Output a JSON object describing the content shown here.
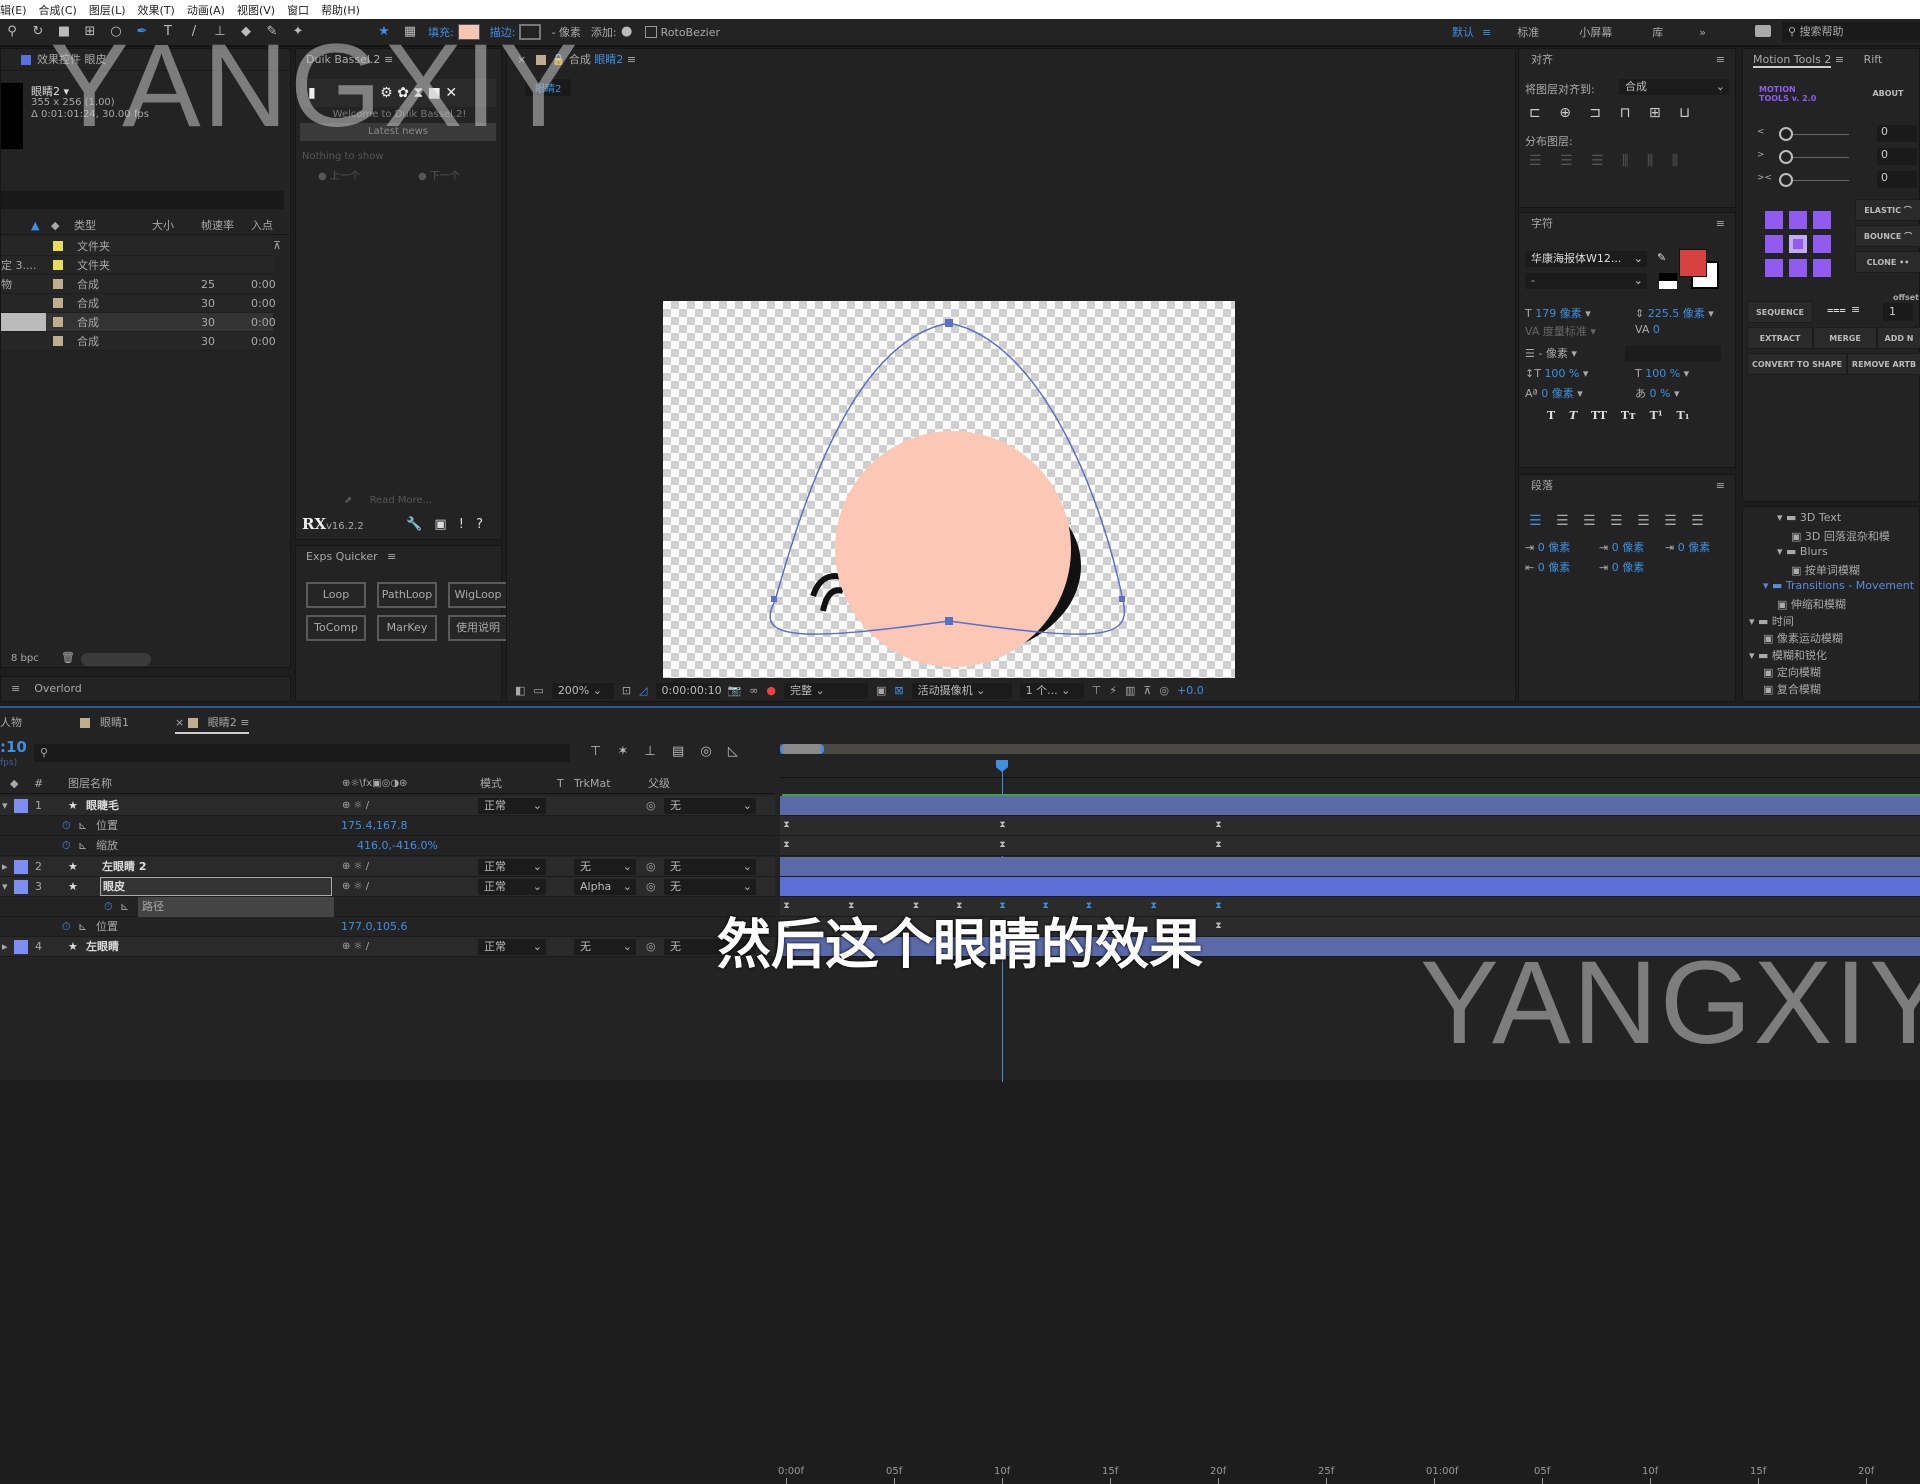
{
  "menu": [
    "辑(E)",
    "合成(C)",
    "图层(L)",
    "效果(T)",
    "动画(A)",
    "视图(V)",
    "窗口",
    "帮助(H)"
  ],
  "toolbar": {
    "fill_label": "填充:",
    "stroke_label": "描边:",
    "stroke_px": "- 像素",
    "add_label": "添加:",
    "rotobezier": "RotoBezier",
    "fill_color": "#f6c4b4",
    "workspaces": [
      "默认",
      "标准",
      "小屏幕",
      "库"
    ],
    "search_placeholder": "搜索帮助"
  },
  "project": {
    "tab": "效果控件 眼皮",
    "comp_name": "眼睛2 ▾",
    "comp_size": "355 x 256 (1.00)",
    "comp_duration": "Δ 0:01:01:24, 30.00 fps",
    "columns": [
      "类型",
      "大小",
      "帧速率",
      "入点"
    ],
    "items": [
      {
        "name": "",
        "type": "文件夹",
        "fps": "",
        "in": "",
        "color": "#e8de56"
      },
      {
        "name": "定 3....",
        "type": "文件夹",
        "fps": "",
        "in": "",
        "color": "#e8de56"
      },
      {
        "name": "物",
        "type": "合成",
        "fps": "25",
        "in": "0:00",
        "color": "#bfae8e"
      },
      {
        "name": "",
        "type": "合成",
        "fps": "30",
        "in": "0:00",
        "color": "#bfae8e"
      },
      {
        "name": "",
        "type": "合成",
        "fps": "30",
        "in": "0:00",
        "color": "#bfae8e"
      },
      {
        "name": "",
        "type": "合成",
        "fps": "30",
        "in": "0:00",
        "color": "#bfae8e"
      }
    ],
    "bpc": "8 bpc",
    "bottom_tab": "Overlord"
  },
  "duik": {
    "tab": "Duik Bassel.2",
    "welcome": "Welcome to Duik Bassel.2!",
    "latest_news": "Latest news",
    "nothing": "Nothing to show",
    "prev": "上一个",
    "next": "下一个",
    "read_more": "Read More...",
    "version": "v16.2.2",
    "logo": "RX"
  },
  "exps": {
    "tab": "Exps Quicker",
    "buttons": [
      "Loop",
      "PathLoop",
      "WigLoop",
      "ToComp",
      "MarKey",
      "使用说明"
    ]
  },
  "viewer": {
    "tab_comp": "合成",
    "tab_name": "眼睛2",
    "crumb": "眼睛2",
    "zoom": "200%",
    "timecode": "0:00:00:10",
    "quality": "完整",
    "camera": "活动摄像机",
    "views": "1 个...",
    "exposure": "+0.0"
  },
  "align": {
    "title": "对齐",
    "align_to_label": "将图层对齐到:",
    "align_to": "合成",
    "distribute_label": "分布图层:"
  },
  "character": {
    "title": "字符",
    "font": "华康海报体W12...",
    "style": "-",
    "fill_color": "#d94040",
    "size": "179 像素",
    "leading": "225.5 像素",
    "kerning": "度量标准",
    "tracking": "0",
    "stroke_width": "- 像素",
    "vscale": "100 %",
    "hscale": "100 %",
    "baseline": "0 像素",
    "tsume": "0 %"
  },
  "paragraph": {
    "title": "段落",
    "indents": [
      "0 像素",
      "0 像素",
      "0 像素",
      "0 像素",
      "0 像素"
    ]
  },
  "motion_tools": {
    "tab": "Motion Tools 2",
    "tab2": "Rift",
    "logo": "MOTION TOOLS v. 2.0",
    "about": "ABOUT",
    "sliders": [
      {
        "label": "<",
        "value": "0"
      },
      {
        "label": ">",
        "value": "0"
      },
      {
        "label": "><",
        "value": "0"
      }
    ],
    "elastic": "ELASTIC",
    "bounce": "BOUNCE",
    "clone": "CLONE",
    "offset_label": "offset",
    "sequence": "SEQUENCE",
    "offset": "1",
    "extract": "EXTRACT",
    "merge": "MERGE",
    "add": "ADD N",
    "convert": "CONVERT TO SHAPE",
    "remove": "REMOVE ARTB",
    "accent": "#8f5bf0"
  },
  "effects_tree": [
    {
      "label": "3D Text",
      "level": 2,
      "folder": true
    },
    {
      "label": "3D 回落混杂和模",
      "level": 3,
      "folder": false
    },
    {
      "label": "Blurs",
      "level": 2,
      "folder": true
    },
    {
      "label": "按单词模糊",
      "level": 3,
      "folder": false
    },
    {
      "label": "Transitions - Movement",
      "level": 1,
      "folder": true
    },
    {
      "label": "伸缩和模糊",
      "level": 2,
      "folder": false
    },
    {
      "label": "时间",
      "level": 0,
      "folder": true
    },
    {
      "label": "像素运动模糊",
      "level": 1,
      "folder": false
    },
    {
      "label": "模糊和锐化",
      "level": 0,
      "folder": true
    },
    {
      "label": "定向模糊",
      "level": 1,
      "folder": false
    },
    {
      "label": "复合模糊",
      "level": 1,
      "folder": false
    }
  ],
  "timeline": {
    "tabs": [
      "人物",
      "眼睛1",
      "眼睛2"
    ],
    "active_tab": "眼睛2",
    "current_time": ":10",
    "fps_hint": "fps)",
    "columns": {
      "name": "图层名称",
      "mode": "模式",
      "t": "T",
      "trkmat": "TrkMat",
      "parent": "父级"
    },
    "ruler": [
      "0:00f",
      "05f",
      "10f",
      "15f",
      "20f",
      "25f",
      "01:00f",
      "05f",
      "10f",
      "15f",
      "20f"
    ],
    "current_frame": 10,
    "rows": [
      {
        "kind": "layer",
        "num": "1",
        "name": "眼睫毛",
        "mode": "正常",
        "trkmat": "",
        "parent": "无",
        "expanded": true
      },
      {
        "kind": "prop",
        "name": "位置",
        "value": "175.4,167.8",
        "keys": [
          0,
          10,
          20
        ]
      },
      {
        "kind": "prop",
        "name": "缩放",
        "value": "416.0,-416.0%",
        "keys": [
          0,
          10,
          20
        ]
      },
      {
        "kind": "layer",
        "num": "2",
        "name": "左眼睛 2",
        "mode": "正常",
        "trkmat": "无",
        "parent": "无",
        "expanded": false
      },
      {
        "kind": "layer",
        "num": "3",
        "name": "眼皮",
        "mode": "正常",
        "trkmat": "Alpha",
        "parent": "无",
        "expanded": true,
        "selected": true
      },
      {
        "kind": "prop",
        "name": "路径",
        "value": "",
        "keys": [
          0,
          3,
          6,
          8,
          10,
          12,
          14,
          17,
          20
        ],
        "sub": true
      },
      {
        "kind": "prop",
        "name": "位置",
        "value": "177.0,105.6",
        "keys": [
          0,
          10,
          20
        ]
      },
      {
        "kind": "layer",
        "num": "4",
        "name": "左眼睛",
        "mode": "正常",
        "trkmat": "无",
        "parent": "无",
        "expanded": false
      }
    ]
  },
  "subtitle": "然后这个眼睛的效果",
  "watermark": "YANGXIY"
}
